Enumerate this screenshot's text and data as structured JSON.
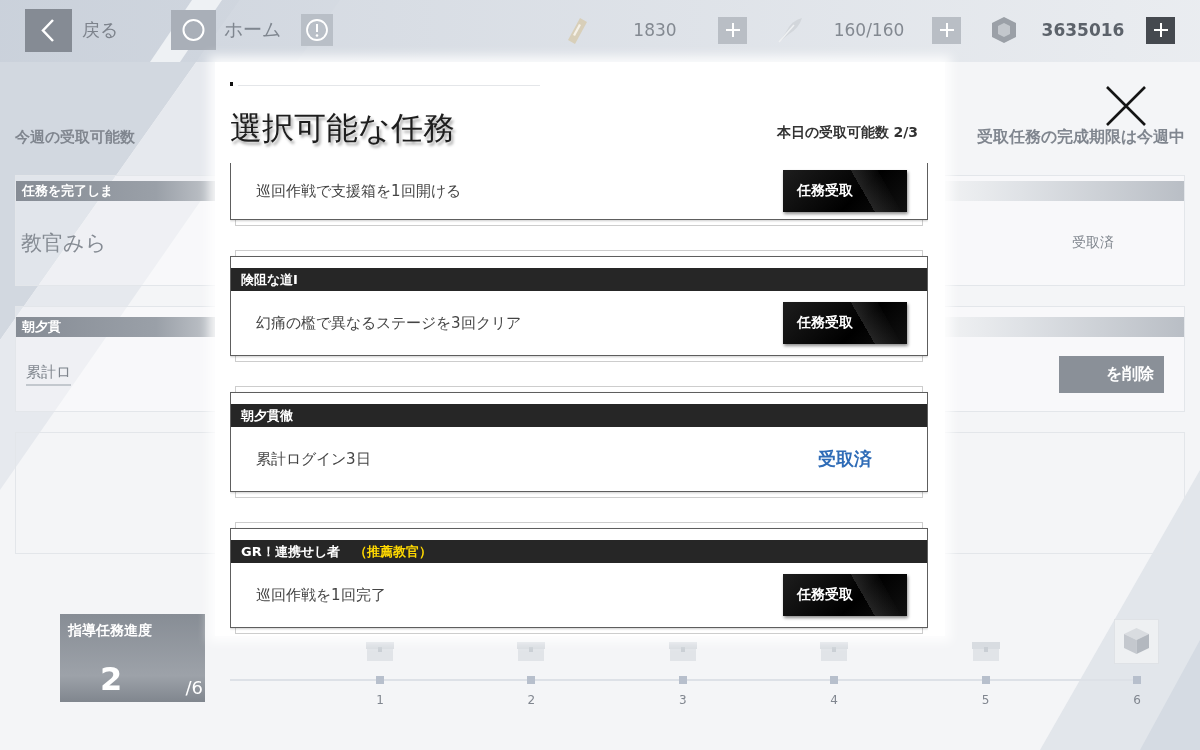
{
  "top_bar": {
    "back_label": "戻る",
    "home_label": "ホーム",
    "resources": [
      {
        "kind": "ticket",
        "amount": "1830"
      },
      {
        "kind": "pen",
        "amount": "160/160"
      },
      {
        "kind": "coin",
        "amount": "3635016"
      }
    ]
  },
  "background": {
    "weekly_label": "今週の受取可能数",
    "deadline_note": "受取任務の完成期限は今週中",
    "cards": [
      {
        "header": "任務を完了しま",
        "body": "教官みら",
        "status": "受取済"
      },
      {
        "header": "朝夕貫",
        "link": "累計ロ",
        "button": "を削除"
      }
    ],
    "progress": {
      "title": "指導任務進度",
      "current": "2",
      "total": "/6",
      "steps": [
        "1",
        "2",
        "3",
        "4",
        "5",
        "6"
      ]
    }
  },
  "dialog": {
    "title": "選択可能な任務",
    "daily_limit": "本日の受取可能数 2/3",
    "quests": [
      {
        "task": "巡回作戦で支援箱を1回開ける",
        "action": {
          "kind": "button",
          "label": "任務受取"
        }
      },
      {
        "title": "険阻な道Ⅰ",
        "task": "幻痛の檻で異なるステージを3回クリア",
        "action": {
          "kind": "button",
          "label": "任務受取"
        }
      },
      {
        "title": "朝夕貫徹",
        "task": "累計ログイン3日",
        "action": {
          "kind": "status",
          "label": "受取済"
        }
      },
      {
        "title": "GR！連携せし者",
        "tag": "（推薦教官）",
        "task": "巡回作戦を1回完了",
        "action": {
          "kind": "button",
          "label": "任務受取"
        }
      }
    ]
  }
}
